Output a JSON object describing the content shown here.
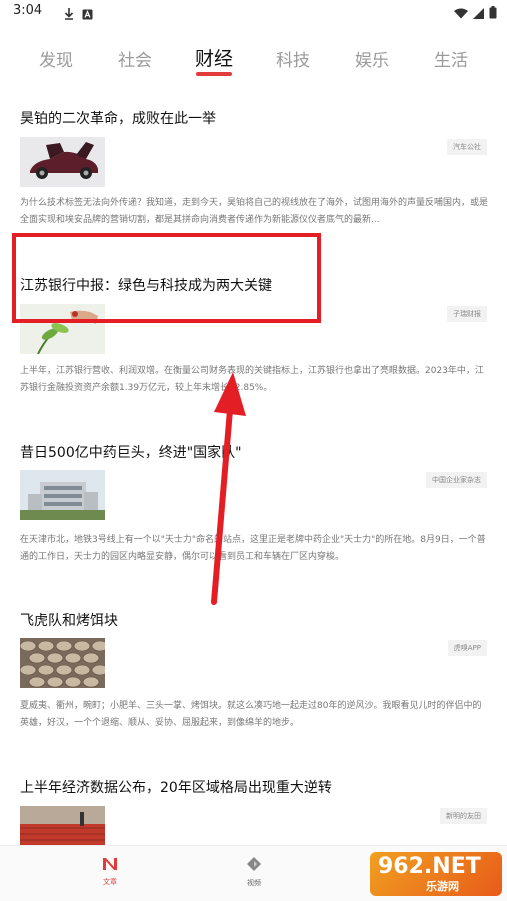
{
  "status_bar": {
    "time": "3:04",
    "left_icons": [
      "download-icon",
      "app-a-icon"
    ],
    "right_icons": [
      "wifi-icon",
      "signal-icon",
      "battery-icon"
    ]
  },
  "tabs": [
    {
      "label": "发现",
      "active": false
    },
    {
      "label": "社会",
      "active": false
    },
    {
      "label": "财经",
      "active": true
    },
    {
      "label": "科技",
      "active": false
    },
    {
      "label": "娱乐",
      "active": false
    },
    {
      "label": "生活",
      "active": false
    }
  ],
  "accent_color": "#e23b3b",
  "articles": [
    {
      "title": "昊铂的二次革命，成败在此一举",
      "source": "汽车公社",
      "summary": "为什么技术标签无法向外传递？我知道，走到今天，昊铂将自己的视线放在了海外，试图用海外的声量反哺国内，或是全面实现和埃安品牌的营销切割，都是其拼命向消费者传递作为新能源仪仪者底气的最新..."
    },
    {
      "title": "江苏银行中报：绿色与科技成为两大关键",
      "source": "子瑞财报",
      "summary": "上半年，江苏银行营收、利润双增。在衡量公司财务表现的关键指标上，江苏银行也拿出了亮眼数据。2023年中，江苏银行金融投资资产余额1.39万亿元，较上年末增长12.85%。"
    },
    {
      "title": "昔日500亿中药巨头，终进\"国家队\"",
      "source": "中国企业家杂志",
      "summary": "在天津市北，地铁3号线上有一个以\"天士力\"命名的站点，这里正是老牌中药企业\"天士力\"的所在地。8月9日，一个普通的工作日，天士力的园区内略显安静，偶尔可以看到员工和车辆在厂区内穿梭。"
    },
    {
      "title": "飞虎队和烤饵块",
      "source": "虎嗅APP",
      "summary": "夏威夷、衢州，畹町；小肥羊、三头一掌、烤饵块。就这么凑巧地一起走过80年的逆风沙。我眼看见儿时的伴侣中的英雄，好汉，一个个退缩、顺从、妥协、屈服起来，到像绵羊的地步。"
    },
    {
      "title": "上半年经济数据公布，20年区域格局出现重大逆转",
      "source": "新明的友田",
      "summary": ""
    }
  ],
  "bottom_nav": [
    {
      "label": "文章",
      "icon": "article-icon",
      "active": true
    },
    {
      "label": "视频",
      "icon": "video-icon",
      "active": false
    }
  ],
  "watermark": {
    "brand": "962.NET",
    "sub": "乐游网"
  }
}
